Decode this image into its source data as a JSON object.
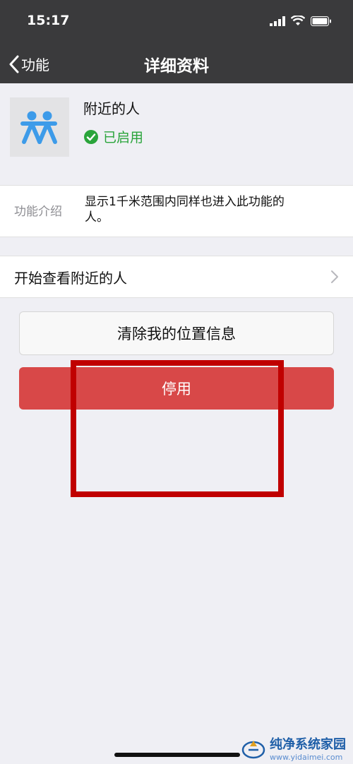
{
  "status_bar": {
    "time": "15:17"
  },
  "nav": {
    "back_label": "功能",
    "title": "详细资料"
  },
  "profile": {
    "name": "附近的人",
    "status": "已启用"
  },
  "intro": {
    "label": "功能介绍",
    "text": "显示1千米范围内同样也进入此功能的人。"
  },
  "row": {
    "label": "开始查看附近的人"
  },
  "buttons": {
    "clear_label": "清除我的位置信息",
    "disable_label": "停用"
  },
  "watermark": {
    "title": "纯净系统家园",
    "url": "www.yidaimei.com"
  },
  "colors": {
    "nav_bg": "#3a3a3c",
    "enabled_green": "#2aa43b",
    "danger_red": "#d84848",
    "highlight_red": "#c00000"
  }
}
